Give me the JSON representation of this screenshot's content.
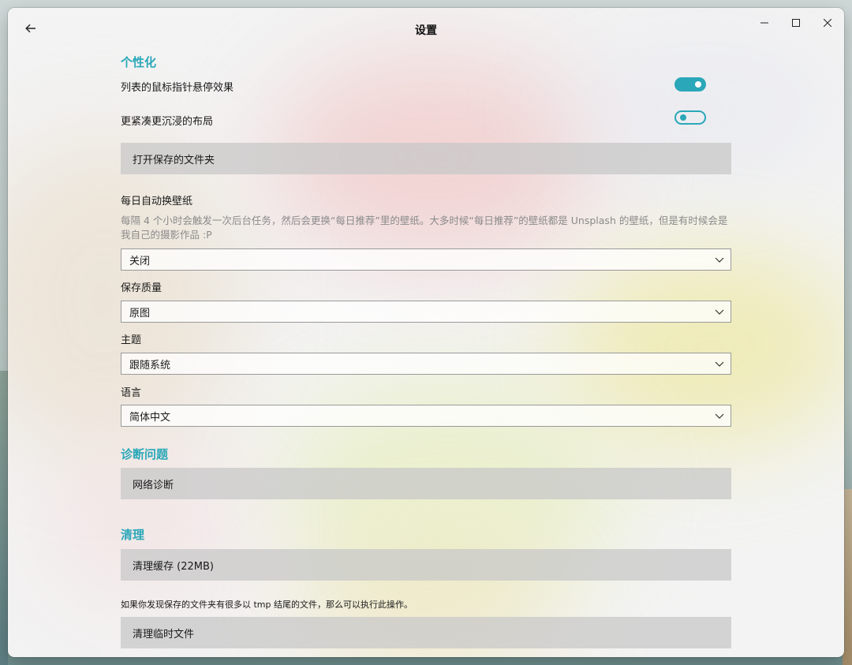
{
  "window": {
    "title": "设置"
  },
  "personalization": {
    "title": "个性化",
    "hover_effect_label": "列表的鼠标指针悬停效果",
    "hover_effect_on": true,
    "compact_layout_label": "更紧凑更沉浸的布局",
    "compact_layout_on": false,
    "open_folder_button": "打开保存的文件夹",
    "auto_wallpaper_label": "每日自动换壁纸",
    "auto_wallpaper_desc": "每隔 4 个小时会触发一次后台任务，然后会更换“每日推荐”里的壁纸。大多时候“每日推荐”的壁纸都是 Unsplash 的壁纸，但是有时候会是我自己的摄影作品 :P",
    "auto_wallpaper_value": "关闭",
    "quality_label": "保存质量",
    "quality_value": "原图",
    "theme_label": "主题",
    "theme_value": "跟随系统",
    "language_label": "语言",
    "language_value": "简体中文"
  },
  "diagnostics": {
    "title": "诊断问题",
    "network_button": "网络诊断"
  },
  "cleanup": {
    "title": "清理",
    "clear_cache_button": "清理缓存 (22MB)",
    "tmp_note": "如果你发现保存的文件夹有很多以 tmp 结尾的文件，那么可以执行此操作。",
    "clear_tmp_button": "清理临时文件"
  },
  "colors": {
    "accent": "#2aa7b8"
  },
  "icons": {
    "back": "back-arrow-icon",
    "minimize": "minimize-icon",
    "maximize": "maximize-icon",
    "close": "close-icon",
    "dropdown": "chevron-down-icon"
  }
}
